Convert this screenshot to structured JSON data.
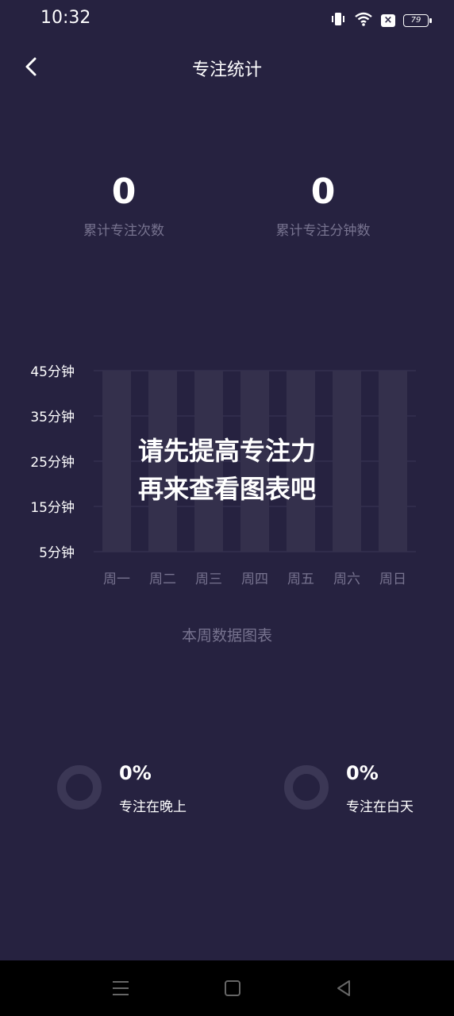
{
  "status_bar": {
    "time": "10:32",
    "battery_level": "79",
    "icons": [
      "vibrate-icon",
      "wifi-icon",
      "notification-x-icon",
      "battery-icon"
    ]
  },
  "header": {
    "title": "专注统计",
    "back_icon": "chevron-left-icon"
  },
  "stats": {
    "total_sessions_value": "0",
    "total_sessions_label": "累计专注次数",
    "total_minutes_value": "0",
    "total_minutes_label": "累计专注分钟数"
  },
  "chart_data": {
    "type": "bar",
    "categories": [
      "周一",
      "周二",
      "周三",
      "周四",
      "周五",
      "周六",
      "周日"
    ],
    "values": [
      0,
      0,
      0,
      0,
      0,
      0,
      0
    ],
    "y_tick_labels": [
      "45分钟",
      "35分钟",
      "25分钟",
      "15分钟",
      "5分钟"
    ],
    "ylim": [
      5,
      45
    ],
    "overlay_message_line1": "请先提高专注力",
    "overlay_message_line2": "再来查看图表吧",
    "grid": true
  },
  "chart_caption": "本周数据图表",
  "distribution": {
    "night_percent": "0%",
    "night_label": "专注在晚上",
    "day_percent": "0%",
    "day_label": "专注在白天"
  },
  "colors": {
    "background": "#262240",
    "bar_placeholder": "#34304c",
    "muted_text": "#77738f",
    "donut_track": "#3b3755"
  },
  "system_nav": {
    "icons": [
      "menu-icon",
      "home-icon",
      "back-triangle-icon"
    ]
  }
}
